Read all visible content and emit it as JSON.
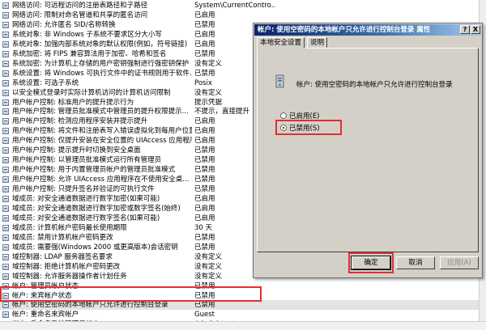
{
  "policies": [
    {
      "name": "网络访问: 可远程访问的注册表路径和子路径",
      "value": "System\\CurrentContro..."
    },
    {
      "name": "网络访问: 限制对命名管道和共享的匿名访问",
      "value": "已启用"
    },
    {
      "name": "网络访问: 允许匿名 SID/名称转换",
      "value": "已禁用"
    },
    {
      "name": "系统对象: 非 Windows 子系统不要求区分大小写",
      "value": "已启用"
    },
    {
      "name": "系统对象: 加强内部系统对象的默认权限(例如，符号链接)",
      "value": "已启用"
    },
    {
      "name": "系统加密: 将 FIPS 兼容算法用于加密、哈希和签名",
      "value": "已禁用"
    },
    {
      "name": "系统加密: 为计算机上存储的用户密钥强制进行强密钥保护",
      "value": "没有定义"
    },
    {
      "name": "系统设置: 将 Windows 可执行文件中的证书规则用于软件...",
      "value": "已禁用"
    },
    {
      "name": "系统设置: 可选子系统",
      "value": "Posix"
    },
    {
      "name": "以安全模式登录时实际计算机访问的计算机访问限制",
      "value": "没有定义"
    },
    {
      "name": "用户帐户控制: 标准用户的提升提示行为",
      "value": "提示凭据"
    },
    {
      "name": "用户帐户控制: 管理员批准模式中管理员的提升权限提示...",
      "value": "不提示，直接提升"
    },
    {
      "name": "用户帐户控制: 检测应用程序安装并提示提升",
      "value": "已启用"
    },
    {
      "name": "用户帐户控制: 将文件和注册表写入错误虚拟化到每用户位置",
      "value": "已启用"
    },
    {
      "name": "用户帐户控制: 仅提升安装在安全位置的 UIAccess 应用程序",
      "value": "已启用"
    },
    {
      "name": "用户帐户控制: 提示提升时切换到安全桌面",
      "value": "已禁用"
    },
    {
      "name": "用户帐户控制: 以管理员批准模式运行所有管理员",
      "value": "已禁用"
    },
    {
      "name": "用户帐户控制: 用于内置管理员帐户的管理员批准模式",
      "value": "已禁用"
    },
    {
      "name": "用户帐户控制: 允许 UIAccess 应用程序在不使用安全桌...",
      "value": "已禁用"
    },
    {
      "name": "用户帐户控制: 只提升签名并验证的可执行文件",
      "value": "已禁用"
    },
    {
      "name": "域成员: 对安全通道数据进行数字加密(如果可能)",
      "value": "已启用"
    },
    {
      "name": "域成员: 对安全通道数据进行数字加密或数字签名(始终)",
      "value": "已启用"
    },
    {
      "name": "域成员: 对安全通道数据进行数字签名(如果可能)",
      "value": "已启用"
    },
    {
      "name": "域成员: 计算机帐户密码最长使用期限",
      "value": "30 天"
    },
    {
      "name": "域成员: 禁用计算机帐户密码更改",
      "value": "已禁用"
    },
    {
      "name": "域成员: 需要强(Windows 2000 或更高版本)会话密钥",
      "value": "已禁用"
    },
    {
      "name": "域控制器: LDAP 服务器签名要求",
      "value": "没有定义"
    },
    {
      "name": "域控制器: 拒绝计算机帐户密码更改",
      "value": "没有定义"
    },
    {
      "name": "域控制器: 允许服务器操作者计划任务",
      "value": "没有定义"
    },
    {
      "name": "帐户: 管理员帐户状态",
      "value": "已禁用"
    },
    {
      "name": "帐户: 来宾帐户状态",
      "value": "已禁用"
    },
    {
      "name": "帐户: 使用空密码的本地帐户只允许进行控制台登录",
      "value": "已禁用"
    },
    {
      "name": "帐户: 重命名来宾帐户",
      "value": "Guest"
    },
    {
      "name": "帐户: 重命名系统管理员帐户",
      "value": "Administrator"
    }
  ],
  "dialog": {
    "title": "帐户: 使用空密码的本地帐户只允许进行控制台登录 属性",
    "help_btn": "?",
    "close_btn": "X",
    "tabs": [
      "本地安全设置",
      "说明"
    ],
    "policy_label": "帐户: 使用空密码的本地帐户只允许进行控制台登录",
    "radio_enabled": "已启用(E)",
    "radio_disabled": "已禁用(S)",
    "selected": "disabled",
    "ok": "确定",
    "cancel": "取消",
    "apply": "应用(A)"
  }
}
